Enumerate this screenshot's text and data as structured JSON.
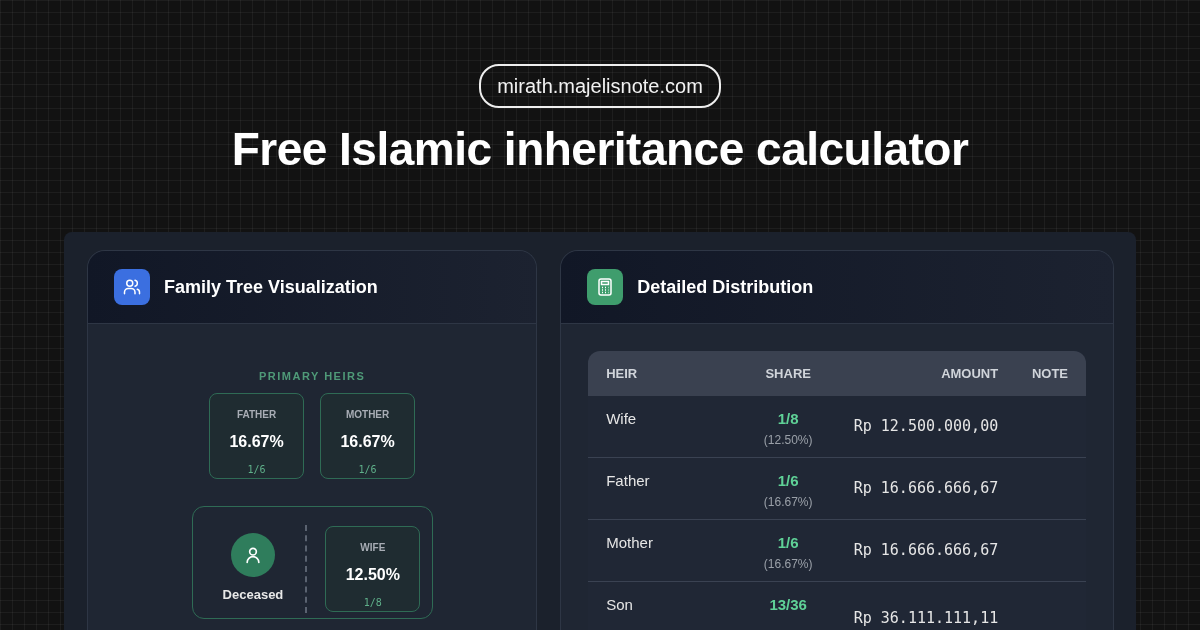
{
  "site_badge": "mirath.majelisnote.com",
  "headline": "Free Islamic inheritance calculator",
  "family_tree": {
    "title": "Family Tree Visualization",
    "section_label": "PRIMARY HEIRS",
    "primary_heirs": [
      {
        "label": "FATHER",
        "percent": "16.67%",
        "fraction": "1/6"
      },
      {
        "label": "MOTHER",
        "percent": "16.67%",
        "fraction": "1/6"
      }
    ],
    "deceased_label": "Deceased",
    "spouses": [
      {
        "label": "WIFE",
        "percent": "12.50%",
        "fraction": "1/8"
      }
    ]
  },
  "distribution": {
    "title": "Detailed Distribution",
    "columns": [
      "HEIR",
      "SHARE",
      "AMOUNT",
      "NOTE"
    ],
    "rows": [
      {
        "heir": "Wife",
        "fraction": "1/8",
        "percent": "(12.50%)",
        "amount": "Rp 12.500.000,00"
      },
      {
        "heir": "Father",
        "fraction": "1/6",
        "percent": "(16.67%)",
        "amount": "Rp 16.666.666,67"
      },
      {
        "heir": "Mother",
        "fraction": "1/6",
        "percent": "(16.67%)",
        "amount": "Rp 16.666.666,67"
      },
      {
        "heir": "Son",
        "fraction": "13/36",
        "amount": "Rp 36.111.111,11"
      }
    ]
  }
}
